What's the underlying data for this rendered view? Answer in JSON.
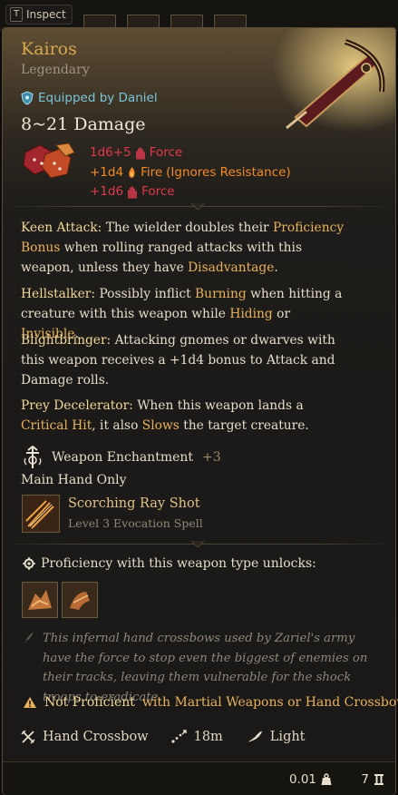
{
  "inspect": {
    "key": "T",
    "label": "Inspect"
  },
  "item": {
    "name": "Kairos",
    "rarity": "Legendary",
    "equipped_by": "Equipped by Daniel",
    "damage_total": "8~21 Damage"
  },
  "damage_lines": [
    {
      "dice": "1d6+5",
      "type": "Force",
      "note": "",
      "color": "#e0394e"
    },
    {
      "dice": "+1d4",
      "type": "Fire",
      "note": " (Ignores Resistance)",
      "color": "#f08a2a"
    },
    {
      "dice": "+1d6",
      "type": "Force",
      "note": "",
      "color": "#e0394e"
    }
  ],
  "passives": {
    "keen": {
      "title": "Keen Attack:",
      "text1": " The wielder doubles their ",
      "kw1": "Proficiency Bonus",
      "text2": " when rolling ranged attacks with this weapon, unless they have ",
      "kw2": "Disadvantage",
      "text3": "."
    },
    "hellstalker": {
      "title": "Hellstalker:",
      "text1": " Possibly inflict ",
      "kw1": "Burning",
      "text2": " when hitting a creature with this weapon while ",
      "kw2": "Hiding",
      "text3": " or ",
      "kw3": "Invisible",
      "text4": "."
    },
    "blightbringer": {
      "title": "Blightbringer:",
      "text": " Attacking gnomes or dwarves with this weapon receives a +1d4 bonus to Attack and Damage rolls."
    },
    "prey": {
      "title": "Prey Decelerator:",
      "text1": " When this weapon lands a ",
      "kw1": "Critical Hit",
      "text2": ", it also ",
      "kw2": "Slows",
      "text3": " the target creature."
    }
  },
  "enchantment": {
    "label": "Weapon Enchantment",
    "value": "+3"
  },
  "hand": "Main Hand Only",
  "spell": {
    "name": "Scorching Ray Shot",
    "subtitle": "Level 3 Evocation Spell"
  },
  "proficiency_unlocks": "Proficiency with this weapon type unlocks:",
  "lore": "This infernal hand crossbows used by Zariel's army have the force to stop even the biggest of enemies on their tracks, leaving them vulnerable for the shock troops to eradicate.",
  "warning": {
    "not_proficient": "Not Proficient",
    "rest": " with Martial Weapons or Hand Crossbows"
  },
  "properties": {
    "type": "Hand Crossbow",
    "range": "18m",
    "weight_class": "Light"
  },
  "footer": {
    "weight": "0.01",
    "value": "7"
  },
  "colors": {
    "legendary": "#d9a84e",
    "force": "#e0394e",
    "fire": "#f08a2a",
    "keyword": "#e8b25c",
    "equipped": "#7cc4d8"
  }
}
